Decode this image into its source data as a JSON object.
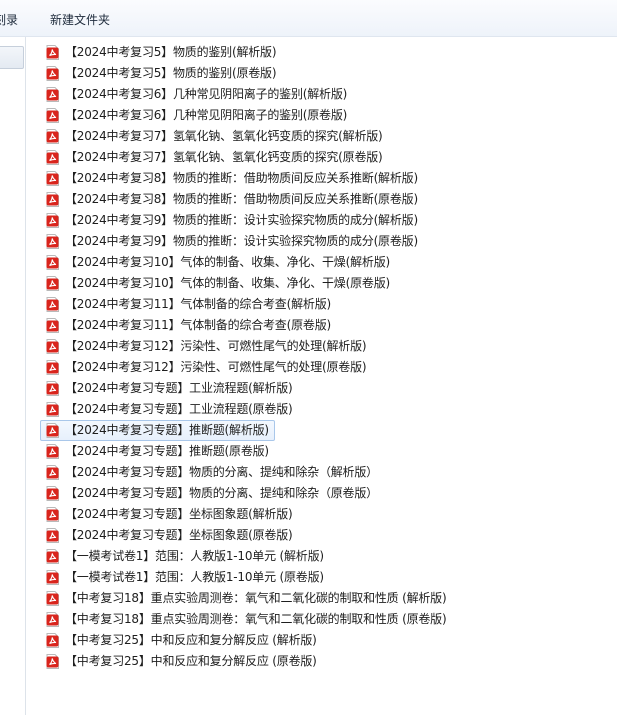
{
  "toolbar": {
    "burn_label": "刻录",
    "new_folder_label": "新建文件夹"
  },
  "icons": {
    "file_type": "pdf-icon"
  },
  "colors": {
    "pdf_red": "#d9251d",
    "selection_border": "#a9c7ea"
  },
  "files": [
    {
      "name": "【2024中考复习5】物质的鉴别(解析版)"
    },
    {
      "name": "【2024中考复习5】物质的鉴别(原卷版)"
    },
    {
      "name": "【2024中考复习6】几种常见阴阳离子的鉴别(解析版)"
    },
    {
      "name": "【2024中考复习6】几种常见阴阳离子的鉴别(原卷版)"
    },
    {
      "name": "【2024中考复习7】氢氧化钠、氢氧化钙变质的探究(解析版)"
    },
    {
      "name": "【2024中考复习7】氢氧化钠、氢氧化钙变质的探究(原卷版)"
    },
    {
      "name": "【2024中考复习8】物质的推断：借助物质间反应关系推断(解析版)"
    },
    {
      "name": "【2024中考复习8】物质的推断：借助物质间反应关系推断(原卷版)"
    },
    {
      "name": "【2024中考复习9】物质的推断：设计实验探究物质的成分(解析版)"
    },
    {
      "name": "【2024中考复习9】物质的推断：设计实验探究物质的成分(原卷版)"
    },
    {
      "name": "【2024中考复习10】气体的制备、收集、净化、干燥(解析版)"
    },
    {
      "name": "【2024中考复习10】气体的制备、收集、净化、干燥(原卷版)"
    },
    {
      "name": "【2024中考复习11】气体制备的综合考查(解析版)"
    },
    {
      "name": "【2024中考复习11】气体制备的综合考查(原卷版)"
    },
    {
      "name": "【2024中考复习12】污染性、可燃性尾气的处理(解析版)"
    },
    {
      "name": "【2024中考复习12】污染性、可燃性尾气的处理(原卷版)"
    },
    {
      "name": "【2024中考复习专题】工业流程题(解析版)"
    },
    {
      "name": "【2024中考复习专题】工业流程题(原卷版)"
    },
    {
      "name": "【2024中考复习专题】推断题(解析版)",
      "selected": true
    },
    {
      "name": "【2024中考复习专题】推断题(原卷版)"
    },
    {
      "name": "【2024中考复习专题】物质的分离、提纯和除杂（解析版）"
    },
    {
      "name": "【2024中考复习专题】物质的分离、提纯和除杂（原卷版）"
    },
    {
      "name": "【2024中考复习专题】坐标图象题(解析版)"
    },
    {
      "name": "【2024中考复习专题】坐标图象题(原卷版)"
    },
    {
      "name": "【一模考试卷1】范围：人教版1-10单元 (解析版)"
    },
    {
      "name": "【一模考试卷1】范围：人教版1-10单元 (原卷版)"
    },
    {
      "name": "【中考复习18】重点实验周测卷：氧气和二氧化碳的制取和性质 (解析版)"
    },
    {
      "name": "【中考复习18】重点实验周测卷：氧气和二氧化碳的制取和性质 (原卷版)"
    },
    {
      "name": "【中考复习25】中和反应和复分解反应 (解析版)"
    },
    {
      "name": "【中考复习25】中和反应和复分解反应 (原卷版)"
    }
  ]
}
